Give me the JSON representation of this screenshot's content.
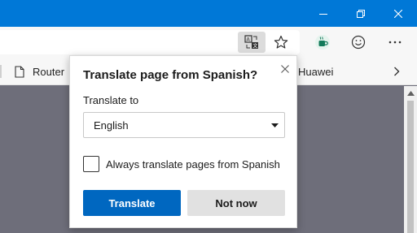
{
  "window": {
    "controls": {
      "minimize_icon": "minimize-icon",
      "restore_icon": "restore-icon",
      "close_icon": "close-icon"
    },
    "accent_color": "#0078d7"
  },
  "toolbar": {
    "icons": [
      "translate-icon",
      "star-icon",
      "coffee-extension-icon",
      "smiley-icon",
      "more-icon"
    ]
  },
  "favorites": {
    "items": [
      {
        "label": "Router",
        "icon": "page-icon"
      },
      {
        "label": "Huawei"
      }
    ],
    "overflow_icon": "chevron-right-icon"
  },
  "translate_popup": {
    "title": "Translate page from Spanish?",
    "translate_to_label": "Translate to",
    "selected_language": "English",
    "always_translate_label": "Always translate pages from Spanish",
    "always_translate_checked": false,
    "translate_button": "Translate",
    "not_now_button": "Not now",
    "primary_color": "#0067c0"
  }
}
